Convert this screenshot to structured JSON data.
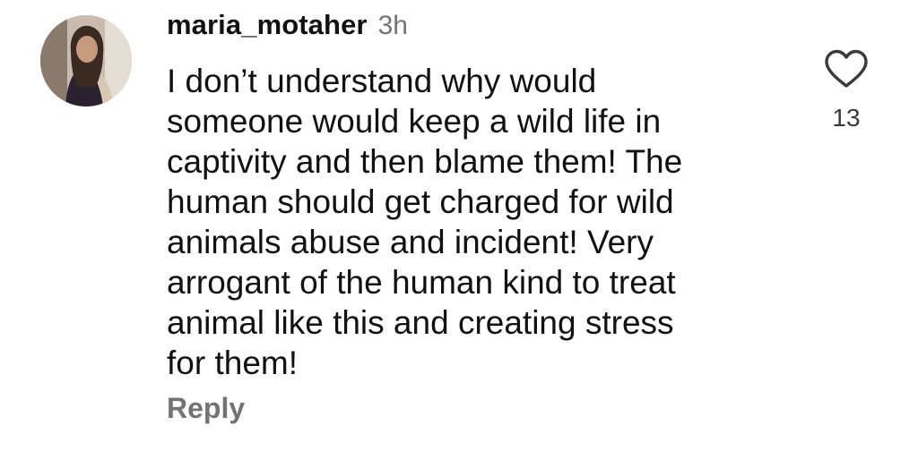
{
  "comment": {
    "username": "maria_motaher",
    "timestamp": "3h",
    "lines": [
      "I don’t understand why would",
      "someone would keep a wild life in",
      "captivity and then blame them! The",
      "human should get charged for wild",
      "animals abuse and incident! Very",
      "arrogant of the human kind to treat",
      "animal like this and creating stress",
      "for them!"
    ],
    "reply_label": "Reply",
    "like_count": "13",
    "like_icon": "heart-outline-icon"
  },
  "colors": {
    "primary_text": "#111111",
    "secondary_text": "#737373"
  }
}
